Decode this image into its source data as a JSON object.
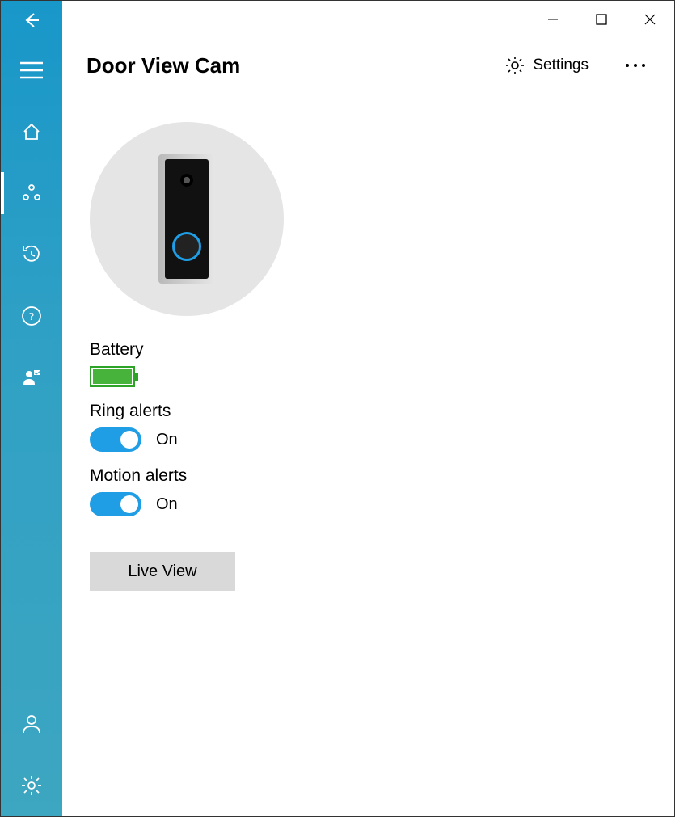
{
  "window": {
    "controls": {
      "minimize": "−",
      "maximize": "▢",
      "close": "✕"
    }
  },
  "rail": {
    "back": "back",
    "items": [
      "menu",
      "home",
      "devices",
      "history",
      "help",
      "neighbors"
    ],
    "bottom": [
      "account",
      "settings"
    ]
  },
  "header": {
    "title": "Door View Cam",
    "settings_label": "Settings"
  },
  "device": {
    "image_alt": "Door View Cam device"
  },
  "battery": {
    "label": "Battery",
    "level_percent": 100
  },
  "ring_alerts": {
    "label": "Ring alerts",
    "state": "On",
    "enabled": true
  },
  "motion_alerts": {
    "label": "Motion alerts",
    "state": "On",
    "enabled": true
  },
  "live_view": {
    "button_label": "Live View"
  }
}
